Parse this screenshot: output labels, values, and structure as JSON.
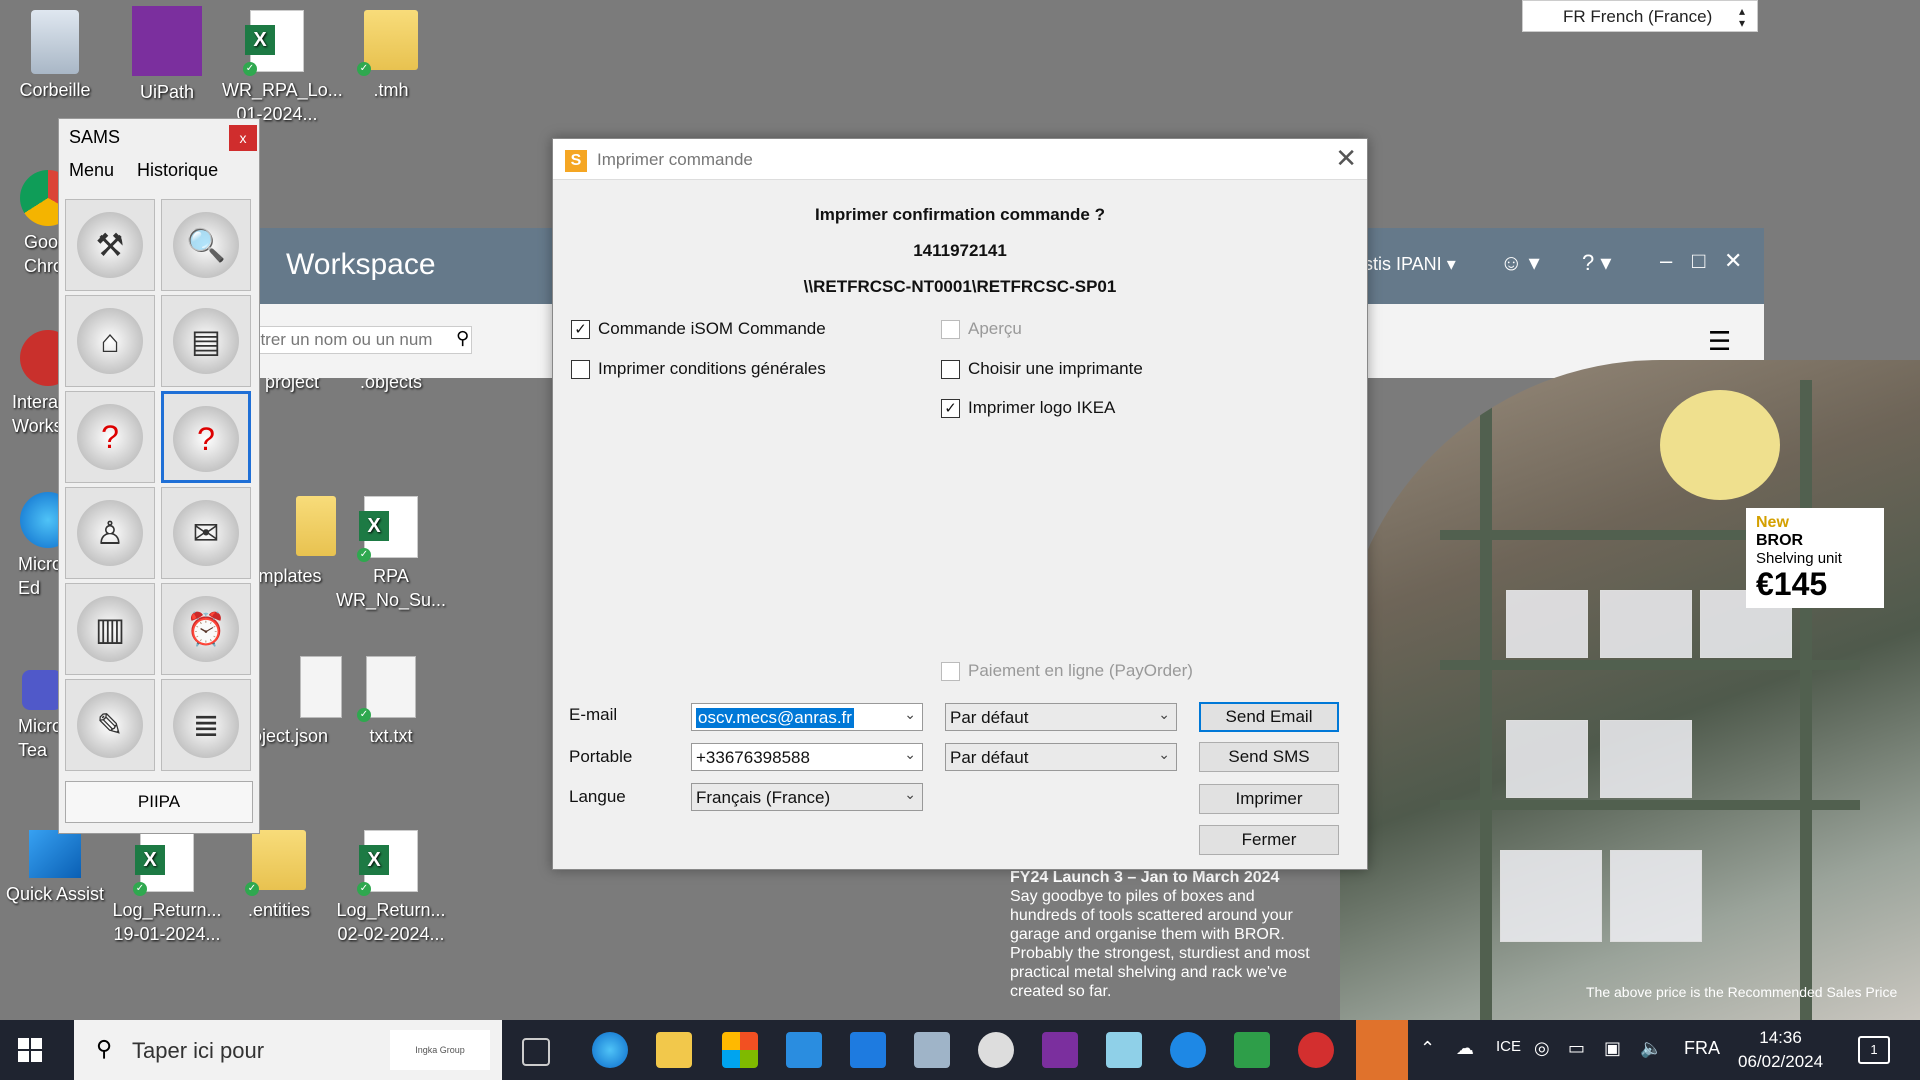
{
  "desktop": {
    "icons": [
      {
        "label": "Corbeille",
        "type": "recycle"
      },
      {
        "label": "UiPath",
        "type": "uipath"
      },
      {
        "label": "WR_RPA_Lo...\n01-2024...",
        "type": "excel"
      },
      {
        "label": ".tmh",
        "type": "folder"
      },
      {
        "label": "Goo\nChro",
        "type": "chrome"
      },
      {
        "label": "Intera\nWorks",
        "type": "app"
      },
      {
        "label": "project",
        "type": "folder"
      },
      {
        "label": ".objects",
        "type": "folder"
      },
      {
        "label": "Micro\nEd",
        "type": "edge"
      },
      {
        "label": "mplates",
        "type": "folder"
      },
      {
        "label": "RPA\nWR_No_Su...",
        "type": "excel"
      },
      {
        "label": "Micro\nTea",
        "type": "teams"
      },
      {
        "label": "oject.json",
        "type": "file"
      },
      {
        "label": "txt.txt",
        "type": "file"
      },
      {
        "label": "Quick Assist",
        "type": "quickassist"
      },
      {
        "label": "Log_Return...\n19-01-2024...",
        "type": "excel"
      },
      {
        "label": ".entities",
        "type": "folder"
      },
      {
        "label": "Log_Return...\n02-02-2024...",
        "type": "excel"
      }
    ]
  },
  "language_selector": {
    "value": "FR French (France)"
  },
  "workspace": {
    "title": "Workspace",
    "user": "istis IPANI",
    "search_placeholder": "ntrer un nom ou un num"
  },
  "sams_panel": {
    "title": "SAMS",
    "close_label": "x",
    "menu": [
      "Menu",
      "Historique"
    ],
    "footer_button": "PIIPA"
  },
  "dialog": {
    "title": "Imprimer commande",
    "question": "Imprimer confirmation commande ?",
    "order_number": "1411972141",
    "printer_path": "\\\\RETFRCSC-NT0001\\RETFRCSC-SP01",
    "checkboxes": {
      "commande_isom": {
        "label": "Commande iSOM Commande",
        "checked": true
      },
      "conditions": {
        "label": "Imprimer conditions générales",
        "checked": false
      },
      "apercu": {
        "label": "Aperçu",
        "checked": false,
        "disabled": true
      },
      "choisir_imprimante": {
        "label": "Choisir une imprimante",
        "checked": false
      },
      "logo_ikea": {
        "label": "Imprimer logo IKEA",
        "checked": true
      },
      "paiement": {
        "label": "Paiement en ligne (PayOrder)",
        "checked": false,
        "disabled": true
      }
    },
    "fields": {
      "email_label": "E-mail",
      "email_value": "oscv.mecs@anras.fr",
      "email_option": "Par défaut",
      "portable_label": "Portable",
      "portable_value": "+33676398588",
      "portable_option": "Par défaut",
      "langue_label": "Langue",
      "langue_value": "Français (France)"
    },
    "buttons": {
      "send_email": "Send Email",
      "send_sms": "Send SMS",
      "imprimer": "Imprimer",
      "fermer": "Fermer"
    }
  },
  "promo": {
    "tag_new": "New",
    "tag_name": "BROR",
    "tag_desc": "Shelving unit",
    "tag_price": "€145",
    "headline": "FY24 Launch 3 – Jan to March 2024",
    "body": "Say goodbye to piles of boxes and hundreds of tools scattered around your garage and organise them with BROR. Probably the strongest, sturdiest and most practical metal shelving and rack we've created so far.",
    "footnote": "The above price is the Recommended Sales Price"
  },
  "taskbar": {
    "search_placeholder": "Taper ici pour",
    "search_logo_text": "Ingka Group",
    "language": "FRA",
    "time": "14:36",
    "date": "06/02/2024",
    "notifications": "1",
    "tray_text": "ICE"
  },
  "colors": {
    "desktop_bg": "#7b7b7b",
    "workspace_bar": "#65798a",
    "accent": "#0078d7",
    "taskbar": "#1f2430"
  }
}
